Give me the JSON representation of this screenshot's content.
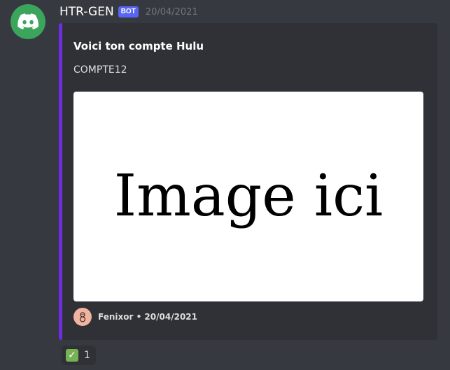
{
  "author": {
    "name": "HTR-GEN",
    "tag": "BOT",
    "timestamp": "20/04/2021",
    "avatar_icon": "discord-logo-icon",
    "avatar_color": "#3ba55c"
  },
  "embed": {
    "accent_color": "#6c2ee0",
    "title": "Voici ton compte Hulu",
    "description": "COMPTE12",
    "image_text": "Image ici",
    "footer": {
      "text": "Fenixor • 20/04/2021",
      "icon": "footer-avatar-icon"
    }
  },
  "reaction": {
    "emoji": "white-check-mark-icon",
    "count": "1"
  }
}
